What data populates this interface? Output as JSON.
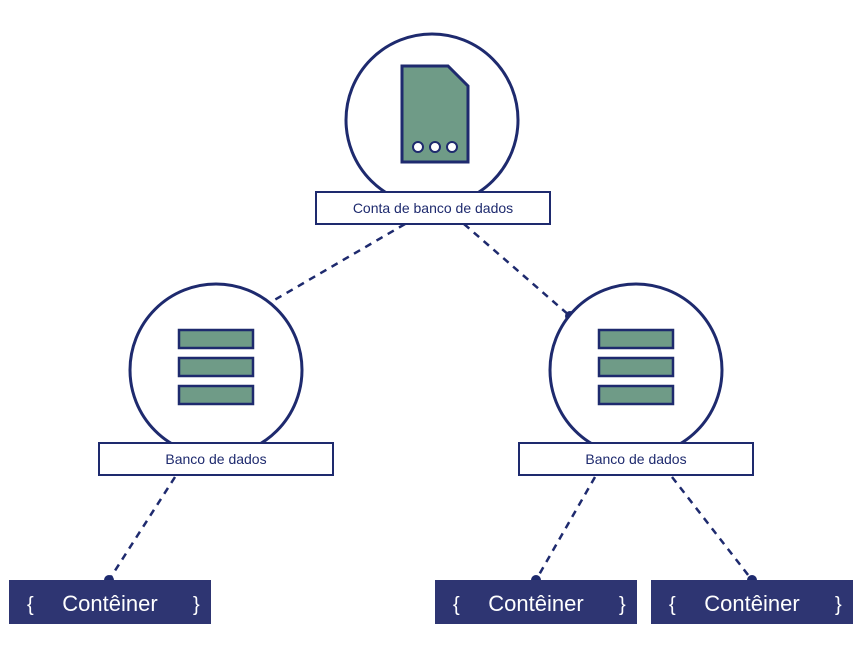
{
  "diagram": {
    "nodes": {
      "account": {
        "label": "Conta de banco de dados",
        "type": "database-account"
      },
      "database1": {
        "label": "Banco de dados",
        "type": "database"
      },
      "database2": {
        "label": "Banco de dados",
        "type": "database"
      },
      "container1": {
        "label": "Contêiner",
        "type": "container"
      },
      "container2": {
        "label": "Contêiner",
        "type": "container"
      },
      "container3": {
        "label": "Contêiner",
        "type": "container"
      }
    },
    "edges": [
      {
        "from": "account",
        "to": "database1"
      },
      {
        "from": "account",
        "to": "database2"
      },
      {
        "from": "database1",
        "to": "container1"
      },
      {
        "from": "database2",
        "to": "container2"
      },
      {
        "from": "database2",
        "to": "container3"
      }
    ],
    "colors": {
      "stroke": "#1e2a6e",
      "iconFill": "#6f9b87",
      "containerBg": "#2e3572",
      "labelBoxBg": "#ffffff",
      "textDark": "#1e2a6e",
      "textLight": "#ffffff"
    }
  }
}
